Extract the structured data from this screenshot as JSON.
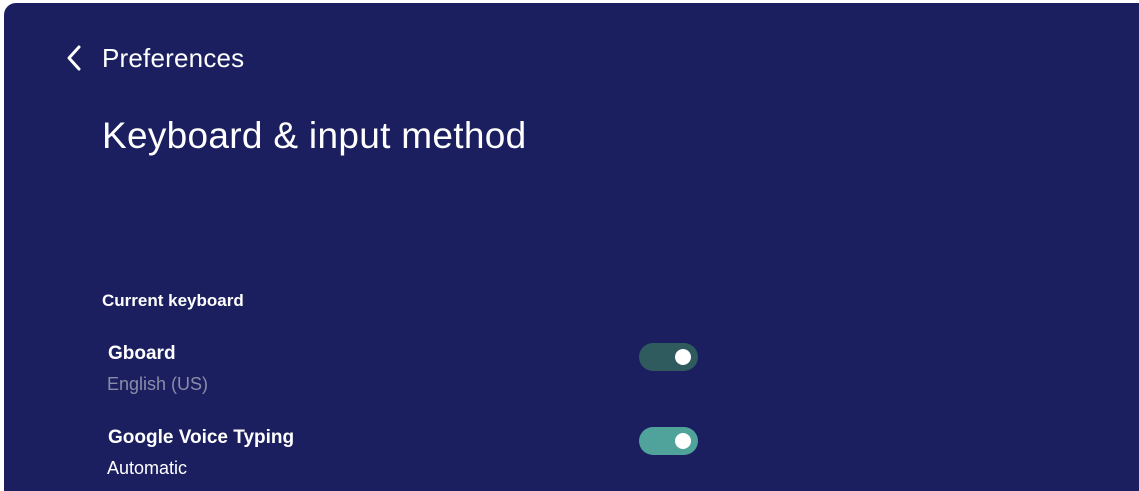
{
  "header": {
    "back_label": "Preferences",
    "title": "Keyboard & input method"
  },
  "section": {
    "header": "Current keyboard"
  },
  "settings": [
    {
      "title": "Gboard",
      "subtitle": "English (US)",
      "enabled": true,
      "toggle_state": "on-dimmed"
    },
    {
      "title": "Google Voice Typing",
      "subtitle": "Automatic",
      "enabled": true,
      "toggle_state": "on"
    }
  ],
  "colors": {
    "background": "#1b1f5f",
    "toggle_on": "#4fa39b",
    "toggle_on_dimmed": "#2f5a5e",
    "subtitle_dim": "#8a8da8",
    "text": "#ffffff"
  },
  "icons": {
    "back": "chevron-left-icon"
  }
}
